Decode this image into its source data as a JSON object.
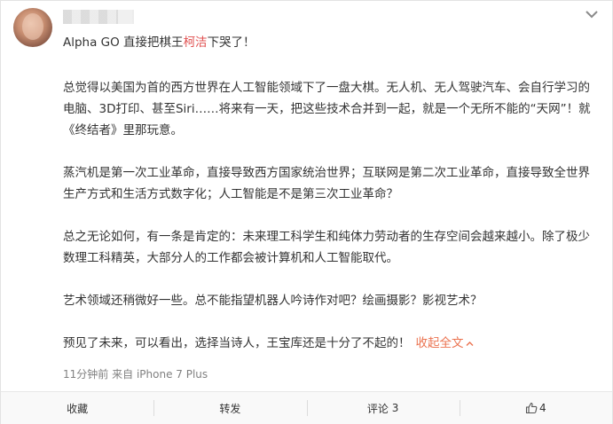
{
  "post": {
    "header": {
      "avatar_icon": "user-avatar-icon",
      "menu_icon": "chevron-down-icon"
    },
    "title": {
      "before": "Alpha GO 直接把棋王",
      "highlight": "柯洁",
      "after": "下哭了！",
      "highlight_color": "#e05050"
    },
    "paragraphs": [
      "总觉得以美国为首的西方世界在人工智能领域下了一盘大棋。无人机、无人驾驶汽车、会自行学习的电脑、3D打印、甚至Siri……将来有一天，把这些技术合并到一起，就是一个无所不能的“天网”！就《终结者》里那玩意。",
      "蒸汽机是第一次工业革命，直接导致西方国家统治世界；互联网是第二次工业革命，直接导致全世界生产方式和生活方式数字化；人工智能是不是第三次工业革命？",
      "总之无论如何，有一条是肯定的：未来理工科学生和纯体力劳动者的生存空间会越来越小。除了极少数理工科精英，大部分人的工作都会被计算机和人工智能取代。",
      "艺术领域还稍微好一些。总不能指望机器人吟诗作对吧？绘画摄影？影视艺术？"
    ],
    "last_paragraph": "预见了未来，可以看出，选择当诗人，王宝库还是十分了不起的！",
    "collapse_label": "收起全文",
    "collapse_icon": "chevron-up-icon",
    "link_color": "#eb7350",
    "meta": {
      "time": "11分钟前",
      "source_prefix": "来自",
      "source": "iPhone 7 Plus"
    }
  },
  "actions": {
    "favorite_label": "收藏",
    "repost_label": "转发",
    "comment_label": "评论",
    "comment_count": "3",
    "like_icon": "thumbs-up-icon",
    "like_count": "4"
  }
}
